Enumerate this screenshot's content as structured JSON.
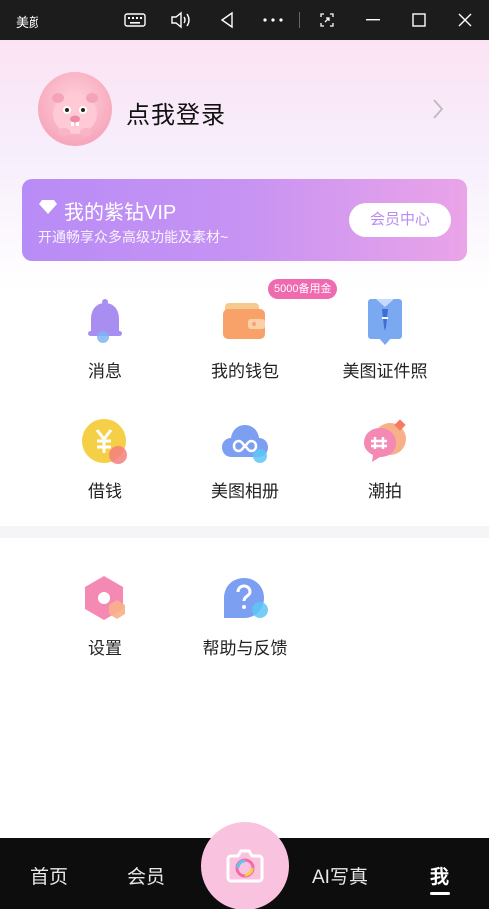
{
  "window": {
    "app_name": "美颜相机",
    "buttons": [
      "keyboard-icon",
      "volume-icon",
      "back-icon",
      "more-icon",
      "screenshot-icon",
      "minimize-icon",
      "maximize-icon",
      "close-icon"
    ]
  },
  "profile": {
    "login_text": "点我登录"
  },
  "vip": {
    "title": "我的紫钻VIP",
    "subtitle": "开通畅享众多高级功能及素材~",
    "button": "会员中心"
  },
  "grid": {
    "badge": "5000备用金",
    "items": [
      {
        "label": "消息",
        "icon": "bell-icon"
      },
      {
        "label": "我的钱包",
        "icon": "wallet-icon"
      },
      {
        "label": "美图证件照",
        "icon": "id-photo-icon"
      },
      {
        "label": "借钱",
        "icon": "yen-icon"
      },
      {
        "label": "美图相册",
        "icon": "cloud-album-icon"
      },
      {
        "label": "潮拍",
        "icon": "hashtag-icon"
      }
    ],
    "more": [
      {
        "label": "设置",
        "icon": "settings-icon"
      },
      {
        "label": "帮助与反馈",
        "icon": "help-icon"
      }
    ]
  },
  "nav": {
    "items": [
      "首页",
      "会员",
      "AI写真",
      "我"
    ],
    "active": "我"
  },
  "colors": {
    "accent": "#b98cf1",
    "badge": "#f06ab0",
    "nav_bg": "#0d0d0d",
    "camera_btn": "#f9c3e0"
  }
}
